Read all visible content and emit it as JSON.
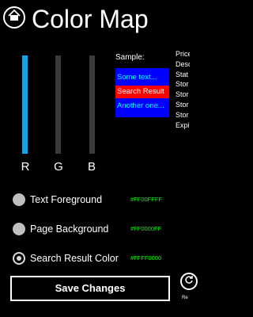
{
  "header": {
    "title": "Color Map",
    "home_icon": "home-icon"
  },
  "sliders": [
    {
      "label": "R",
      "value": 1.0
    },
    {
      "label": "G",
      "value": 0.0
    },
    {
      "label": "B",
      "value": 0.0
    }
  ],
  "sample": {
    "label": "Sample:",
    "items": [
      "Some text...",
      "Search Result",
      "Another one..."
    ]
  },
  "info_list": [
    "Price",
    "Desc",
    "Stat",
    "Stor",
    "Stor",
    "Stor",
    "Stor",
    "Expi"
  ],
  "radios": [
    {
      "label": "Text Foreground",
      "hex": "#FF00FFFF",
      "checked": false
    },
    {
      "label": "Page Background",
      "hex": "#FF0000FF",
      "checked": false
    },
    {
      "label": "Search Result Color",
      "hex": "#FFFF0000",
      "checked": true
    }
  ],
  "save_button": {
    "label": "Save Changes"
  },
  "appbar": {
    "label": "Re",
    "icon": "reset-icon"
  },
  "colors": {
    "accent": "#1ba1e2",
    "sample_bg": "#0000FF",
    "sample_text": "#00FFFF",
    "search_result": "#FF0000",
    "hex_text": "#00FF00"
  }
}
